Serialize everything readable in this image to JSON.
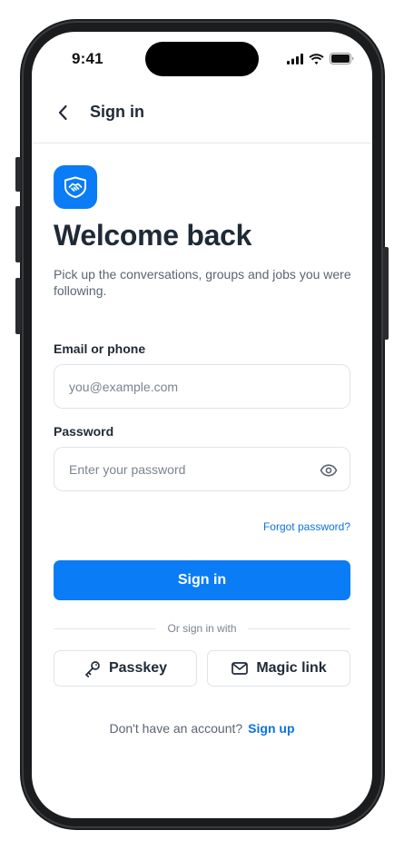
{
  "status_bar": {
    "time": "9:41",
    "icons": [
      "cellular-signal-icon",
      "wifi-icon",
      "battery-icon"
    ]
  },
  "header": {
    "back_icon": "chevron-left-icon",
    "title": "Sign in"
  },
  "logo": {
    "icon": "handshake-icon",
    "color": "#0a7cf5"
  },
  "welcome": {
    "title": "Welcome back",
    "subtitle": "Pick up the conversations, groups and jobs you were following."
  },
  "form": {
    "email": {
      "label": "Email or phone",
      "value": "",
      "placeholder": "you@example.com"
    },
    "password": {
      "label": "Password",
      "value": "",
      "placeholder": "Enter your password",
      "toggle_icon": "eye-icon"
    },
    "forgot_label": "Forgot password?",
    "submit_label": "Sign in"
  },
  "alt_signin": {
    "divider_text": "Or sign in with",
    "passkey": {
      "label": "Passkey",
      "icon": "key-icon"
    },
    "magic_link": {
      "label": "Magic link",
      "icon": "mail-icon"
    }
  },
  "signup": {
    "prompt": "Don't have an account?",
    "link_label": "Sign up"
  },
  "colors": {
    "accent": "#0a7cf5",
    "link": "#0a74e0",
    "text_primary": "#1f2a37",
    "text_secondary": "#5b6472",
    "device_frame": "#1b1c1e"
  }
}
